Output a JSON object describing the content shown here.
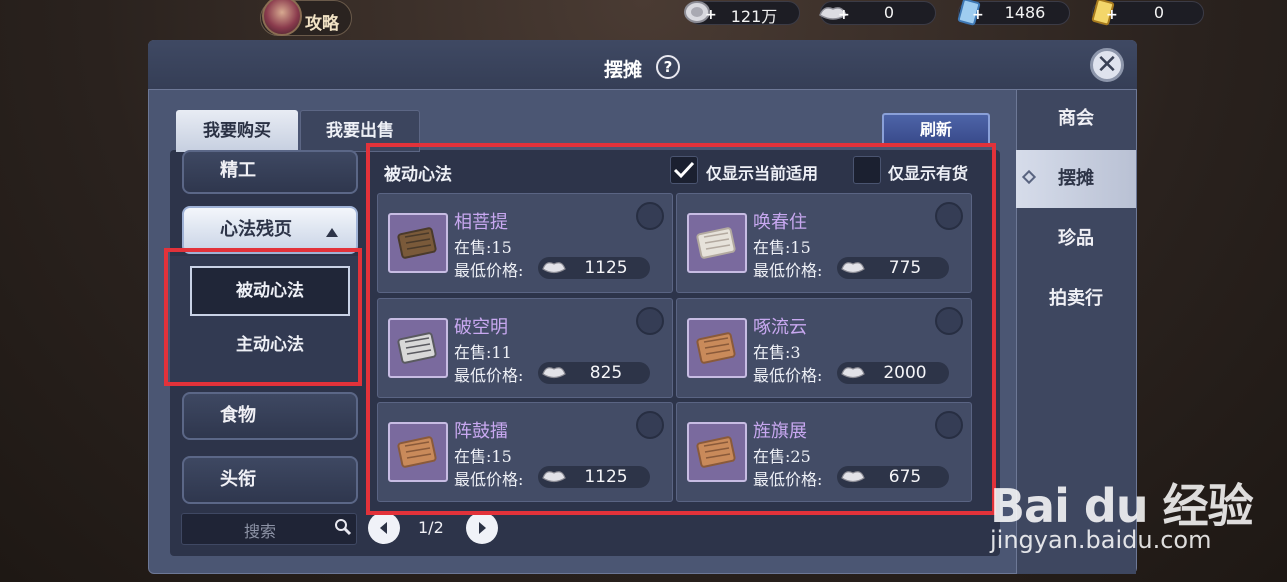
{
  "topbar": {
    "guide_label": "攻略",
    "currencies": [
      {
        "icon": "silver-coin-icon",
        "value": "121万"
      },
      {
        "icon": "silver-ingot-icon",
        "value": "0"
      },
      {
        "icon": "blue-ticket-icon",
        "value": "1486"
      },
      {
        "icon": "gold-ticket-icon",
        "value": "0"
      }
    ]
  },
  "panel": {
    "title": "摆摊",
    "help": "?",
    "close": "✕"
  },
  "right_tabs": [
    {
      "label": "商会",
      "active": false
    },
    {
      "label": "摆摊",
      "active": true
    },
    {
      "label": "珍品",
      "active": false
    },
    {
      "label": "拍卖行",
      "active": false
    }
  ],
  "mode_tabs": {
    "buy": "我要购买",
    "sell": "我要出售"
  },
  "refresh_label": "刷新",
  "categories": {
    "item_0": "精工",
    "expanded": "心法残页",
    "sub_items": [
      "被动心法",
      "主动心法"
    ],
    "item_food": "食物",
    "item_title": "头衔"
  },
  "search": {
    "placeholder": "搜索"
  },
  "pagination": {
    "indicator": "1/2"
  },
  "listing": {
    "category_title": "被动心法",
    "filter_applicable": {
      "label": "仅显示当前适用",
      "checked": true
    },
    "filter_in_stock": {
      "label": "仅显示有货",
      "checked": false
    },
    "stock_prefix": "在售:",
    "price_prefix": "最低价格:",
    "items": [
      {
        "name": "相菩提",
        "stock": "在售:15",
        "price_label": "最低价格:",
        "price": "1125"
      },
      {
        "name": "唤春住",
        "stock": "在售:15",
        "price_label": "最低价格:",
        "price": "775"
      },
      {
        "name": "破空明",
        "stock": "在售:11",
        "price_label": "最低价格:",
        "price": "825"
      },
      {
        "name": "啄流云",
        "stock": "在售:3",
        "price_label": "最低价格:",
        "price": "2000"
      },
      {
        "name": "阵鼓擂",
        "stock": "在售:15",
        "price_label": "最低价格:",
        "price": "1125"
      },
      {
        "name": "旌旗展",
        "stock": "在售:25",
        "price_label": "最低价格:",
        "price": "675"
      }
    ]
  },
  "colors": {
    "panel_bg": "#4b5673",
    "highlight": "#e2323a",
    "item_name": "#c8a8f0"
  },
  "watermark": {
    "logo": "Bai du 经验",
    "url": "jingyan.baidu.com"
  }
}
